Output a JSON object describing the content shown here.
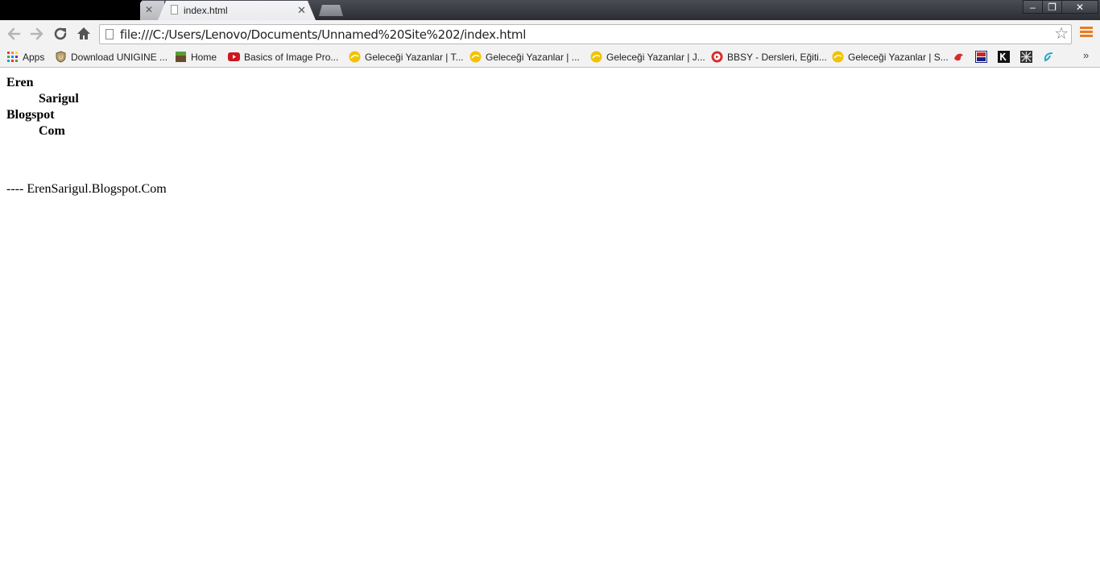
{
  "tabs": [
    {
      "title": ""
    },
    {
      "title": "index.html"
    }
  ],
  "window_controls": {
    "minimize": "–",
    "restore": "❐",
    "close": "✕"
  },
  "address_bar": {
    "url": "file:///C:/Users/Lenovo/Documents/Unnamed%20Site%202/index.html"
  },
  "bookmarks": [
    {
      "label": "Apps",
      "icon": "apps-grid-icon"
    },
    {
      "label": "Download UNIGINE ...",
      "icon": "unigine-icon"
    },
    {
      "label": "Home",
      "icon": "minecraft-icon"
    },
    {
      "label": "Basics of Image Pro...",
      "icon": "youtube-icon"
    },
    {
      "label": "Geleceği Yazanlar | T...",
      "icon": "gy-icon"
    },
    {
      "label": "Geleceği Yazanlar | ...",
      "icon": "gy-icon"
    },
    {
      "label": "Geleceği Yazanlar | J...",
      "icon": "gy-icon"
    },
    {
      "label": "BBSY - Dersleri, Eğiti...",
      "icon": "bbsy-icon"
    },
    {
      "label": "Geleceği Yazanlar | S...",
      "icon": "gy-icon"
    }
  ],
  "bookmarks_overflow": "»",
  "page": {
    "lines": [
      "Eren",
      "Sarigul",
      "Blogspot",
      "Com"
    ],
    "footer": "---- ErenSarigul.Blogspot.Com"
  },
  "colors": {
    "menu_accent": "#e67e22",
    "youtube_red": "#cc181e",
    "gy_yellow": "#f2c200"
  }
}
